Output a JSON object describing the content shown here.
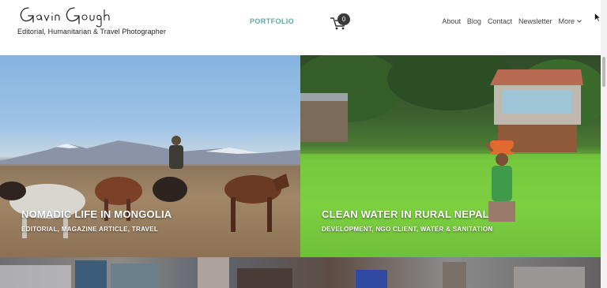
{
  "header": {
    "logo_text": "Gavin Gough",
    "tagline": "Editorial, Humanitarian & Travel Photographer"
  },
  "nav": {
    "portfolio": "PORTFOLIO",
    "cart_count": "0",
    "links": [
      "About",
      "Blog",
      "Contact",
      "Newsletter"
    ],
    "more": "More"
  },
  "tiles": [
    {
      "title": "NOMADIC LIFE IN MONGOLIA",
      "subtitle": "EDITORIAL, MAGAZINE ARTICLE, TRAVEL"
    },
    {
      "title": "CLEAN WATER IN RURAL NEPAL",
      "subtitle": "DEVELOPMENT, NGO CLIENT, WATER & SANITATION"
    }
  ],
  "colors": {
    "accent": "#5ea8a6",
    "text": "#444444",
    "badge": "#3a3a3a"
  },
  "icons": [
    "cart-icon",
    "chevron-down-icon",
    "cursor-icon"
  ]
}
